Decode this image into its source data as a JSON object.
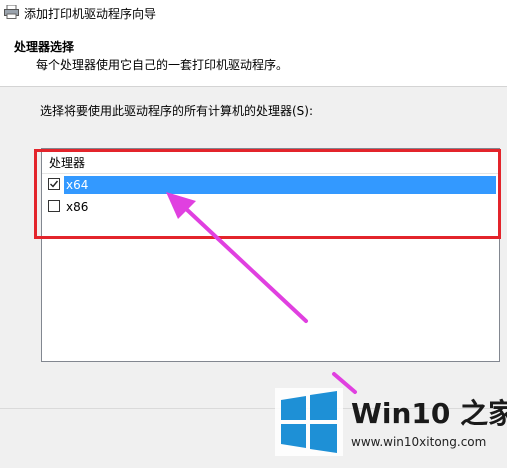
{
  "window": {
    "title": "添加打印机驱动程序向导",
    "icon": "printer-wizard-icon"
  },
  "header": {
    "title": "处理器选择",
    "subtitle": "每个处理器使用它自己的一套打印机驱动程序。"
  },
  "prompt": "选择将要使用此驱动程序的所有计算机的处理器(S):",
  "processor_list": {
    "column_header": "处理器",
    "items": [
      {
        "label": "x64",
        "checked": true,
        "selected": true
      },
      {
        "label": "x86",
        "checked": false,
        "selected": false
      }
    ]
  },
  "annotation": {
    "highlight_color": "#e3242b",
    "arrow_color": "#e040e0"
  },
  "watermark": {
    "brand": "Win10 之家",
    "url": "www.win10xitong.com",
    "logo": "windows-logo-icon",
    "logo_color": "#1e90d6"
  }
}
